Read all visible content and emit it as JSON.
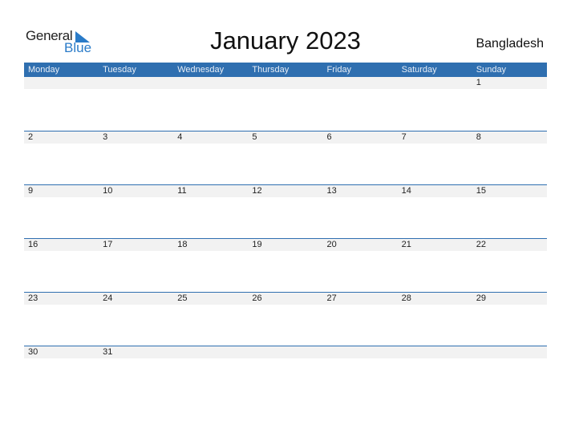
{
  "logo": {
    "general": "General",
    "blue": "Blue"
  },
  "title": "January 2023",
  "country": "Bangladesh",
  "colors": {
    "header": "#2f6fb0",
    "strip": "#f2f2f2",
    "logo_blue": "#2a7bc8"
  },
  "weekdays": [
    "Monday",
    "Tuesday",
    "Wednesday",
    "Thursday",
    "Friday",
    "Saturday",
    "Sunday"
  ],
  "weeks": [
    [
      "",
      "",
      "",
      "",
      "",
      "",
      "1"
    ],
    [
      "2",
      "3",
      "4",
      "5",
      "6",
      "7",
      "8"
    ],
    [
      "9",
      "10",
      "11",
      "12",
      "13",
      "14",
      "15"
    ],
    [
      "16",
      "17",
      "18",
      "19",
      "20",
      "21",
      "22"
    ],
    [
      "23",
      "24",
      "25",
      "26",
      "27",
      "28",
      "29"
    ],
    [
      "30",
      "31",
      "",
      "",
      "",
      "",
      ""
    ]
  ]
}
